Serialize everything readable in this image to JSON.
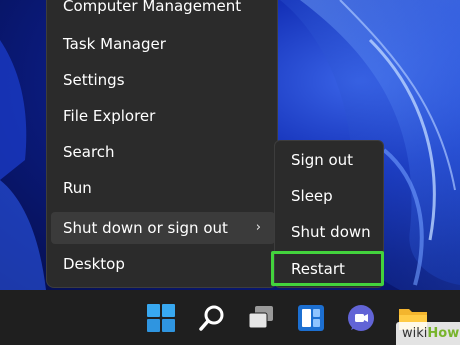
{
  "context_menu": {
    "items": [
      {
        "label": "Computer Management"
      },
      {
        "label": "Task Manager"
      },
      {
        "label": "Settings"
      },
      {
        "label": "File Explorer"
      },
      {
        "label": "Search"
      },
      {
        "label": "Run"
      },
      {
        "label": "Shut down or sign out",
        "has_submenu": true,
        "chevron": "›"
      },
      {
        "label": "Desktop"
      }
    ]
  },
  "power_submenu": {
    "items": [
      {
        "label": "Sign out"
      },
      {
        "label": "Sleep"
      },
      {
        "label": "Shut down"
      },
      {
        "label": "Restart",
        "highlighted": true
      }
    ],
    "highlight_color": "#43d33d"
  },
  "taskbar": {
    "icons": [
      "windows-start-icon",
      "search-icon",
      "task-view-icon",
      "widgets-icon",
      "teams-chat-icon",
      "file-explorer-icon"
    ]
  },
  "watermark": {
    "part1": "wiki",
    "part2": "How"
  },
  "colors": {
    "menu_bg": "#2b2b2b",
    "taskbar_bg": "#1f1f1f",
    "accent": "#43d33d"
  }
}
